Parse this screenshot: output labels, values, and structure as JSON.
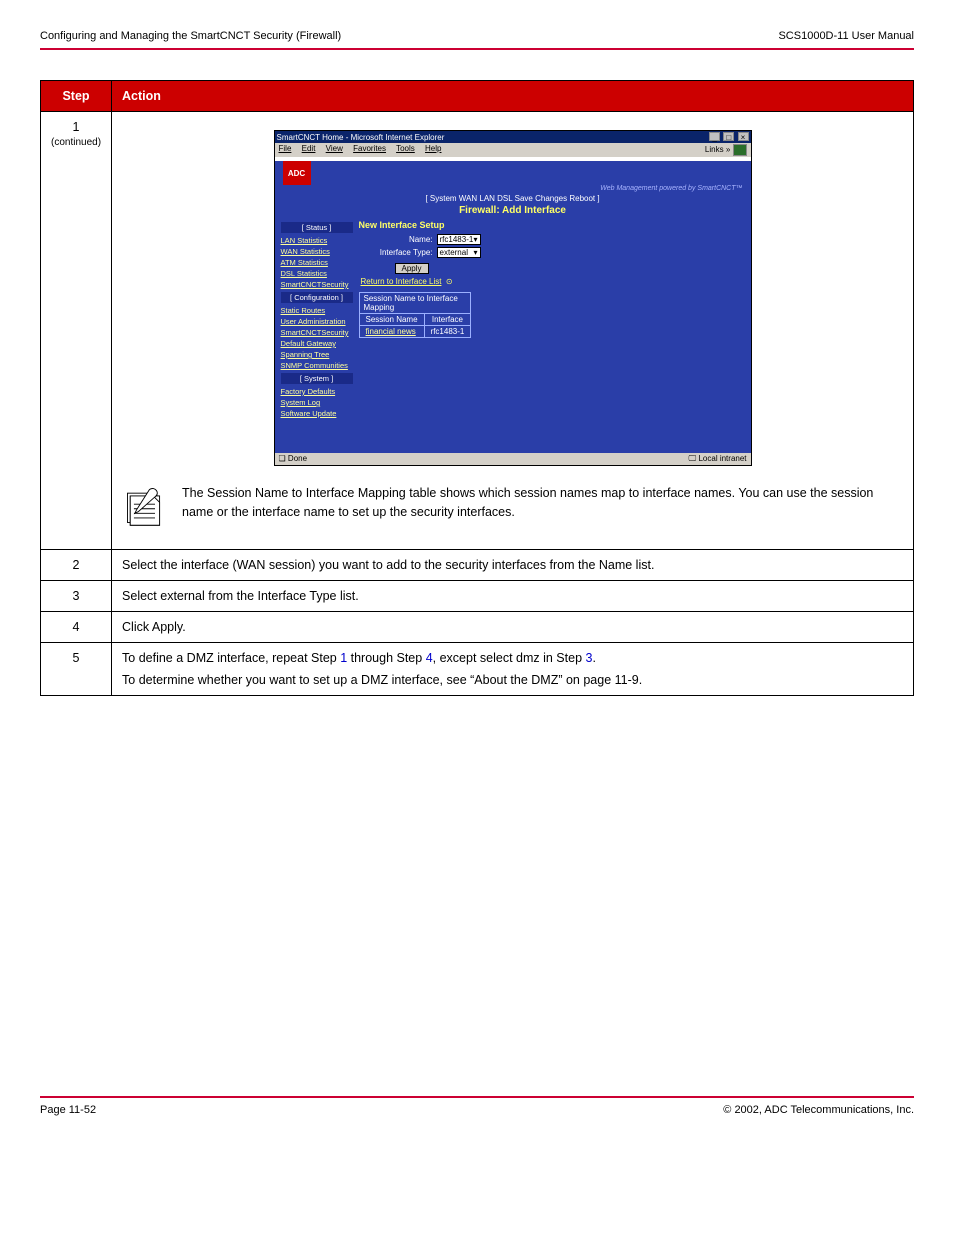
{
  "page": {
    "header_left": "Configuring and Managing the SmartCNCT Security (Firewall)",
    "header_right": "SCS1000D-11 User Manual",
    "footer_left": "Page 11-52",
    "footer_right": "© 2002, ADC Telecommunications, Inc."
  },
  "proc": {
    "col_step": "Step",
    "col_action": "Action",
    "steps": [
      {
        "num": "1",
        "continued": " (continued)",
        "note": "The Session Name to Interface Mapping table shows which session names map to interface names. You can use the session name or the interface name to set up the security interfaces.",
        "shot": {
          "titlebar": "SmartCNCT Home - Microsoft Internet Explorer",
          "menus": [
            "File",
            "Edit",
            "View",
            "Favorites",
            "Tools",
            "Help"
          ],
          "links_label": "Links",
          "logo": "ADC",
          "tagline": "Web Management powered by SmartCNCT™",
          "topnav": "[ System  WAN  LAN  DSL  Save Changes  Reboot ]",
          "pagetitle": "Firewall: Add Interface",
          "sidebar": {
            "sect_status": "[ Status ]",
            "status_items": [
              "LAN Statistics",
              "WAN Statistics",
              "ATM Statistics",
              "DSL Statistics",
              "SmartCNCTSecurity"
            ],
            "sect_config": "[ Configuration ]",
            "config_items": [
              "Static Routes",
              "User Administration",
              "SmartCNCTSecurity",
              "Default Gateway",
              "Spanning Tree",
              "SNMP Communities"
            ],
            "sect_system": "[ System ]",
            "system_items": [
              "Factory Defaults",
              "System Log",
              "Software Update"
            ]
          },
          "panel": {
            "heading": "New Interface Setup",
            "row_name_label": "Name:",
            "row_name_value": "rfc1483-1",
            "row_type_label": "Interface Type:",
            "row_type_value": "external",
            "apply": "Apply",
            "return_link": "Return to Interface List",
            "map_caption": "Session Name to Interface Mapping",
            "map_h1": "Session Name",
            "map_h2": "Interface",
            "map_r1c1": "financial news",
            "map_r1c2": "rfc1483-1"
          },
          "status_done": "Done",
          "status_zone": "Local intranet"
        }
      },
      {
        "num": "2",
        "action": "Select the interface (WAN session) you want to add to the security interfaces from the Name list."
      },
      {
        "num": "3",
        "action": "Select external from the Interface Type list."
      },
      {
        "num": "4",
        "action": "Click Apply."
      },
      {
        "num": "5",
        "action_a": "To define a DMZ interface, repeat Step ",
        "action_link1": "1",
        "action_b": " through Step ",
        "action_link2": "4",
        "action_c": ", except select dmz in Step ",
        "action_link3": "3",
        "action_d": ".",
        "extra": "To determine whether you want to set up a DMZ interface, see “About the DMZ” on page 11-9."
      }
    ]
  }
}
